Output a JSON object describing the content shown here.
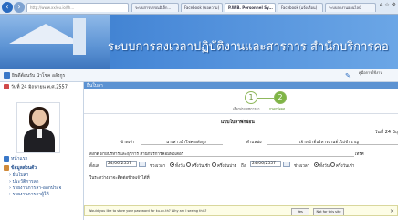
{
  "browser": {
    "address": "http://www.xx/eu.io/th...",
    "tabs": [
      "ระบบสารบรรณอิเล็ก...",
      "Facebook (ขอความ)",
      "P.W.B. Personnel Sy...",
      "Facebook (แจ้งเตือน)",
      "ระบบลางานออนไลน์"
    ]
  },
  "header": {
    "title": "ระบบการลงเวลาปฏิบัติงานและสารการ  สำนักบริการคอ"
  },
  "userbar": {
    "name": "ยินดีต้อนรับ นำโชค อลังกูร",
    "help": "คู่มือการใช้งาน"
  },
  "sidebar": {
    "date": "วันที่ 24 มิถุนายน พ.ศ.2557",
    "menu": [
      "หน้าแรก",
      "ข้อมูลส่วนตัว",
      "ยื่นใบลา",
      "ประวัติการลา",
      "รายงานการลา-ออกประจ",
      "รายงานการลาผู้ใต้"
    ]
  },
  "main": {
    "section": "ยื่นใบลา",
    "steps": {
      "one": "1",
      "two": "2",
      "one_label": "เลือกประเภทการลา",
      "two_label": "กรอกข้อมูล"
    },
    "form": {
      "title": "แบบใบลาพักผ่อน",
      "date_line": "วันที่ 24 มิถุ",
      "label_name": "ข้าพเจ้า",
      "value_name": "นางสาวนำโชค อลังกูร",
      "label_position": "ตำแหน่ง",
      "value_position": "เจ้าหน้าที่บริหารงานทั่วไปชำนาญ",
      "label_dept": "สังกัด ฝ่ายบริหารและธุรการ สำนักบริการคอมพิวเตอร์",
      "label_phone": "โทรศ",
      "label_leave_from": "ตั้งแต่",
      "from_date": "24/06/2557",
      "label_period": "ช่วงเวลา",
      "opt_full_day": "ทั้งวัน",
      "opt_morning": "ครึ่งวันเช้า",
      "opt_afternoon": "ครึ่งวันบ่าย",
      "label_to": "ถึง",
      "to_date": "24/06/2557",
      "label_period2": "ช่วงเวลา",
      "opt_full_day2": "ทั้งวัน",
      "opt_morning2": "ครึ่งวันเช้า",
      "label_contact": "ในระหว่างลาจะติดต่อข้าพเจ้าได้ที่"
    }
  },
  "password_bar": {
    "text": "Would you like to store your password for ku.ac.th? Why am I seeing this?",
    "yes": "Yes",
    "no": "Not for this site"
  },
  "colors": {
    "header_blue": "#3276c6",
    "step_green": "#7eb545",
    "section_bar": "#5b92d2"
  }
}
